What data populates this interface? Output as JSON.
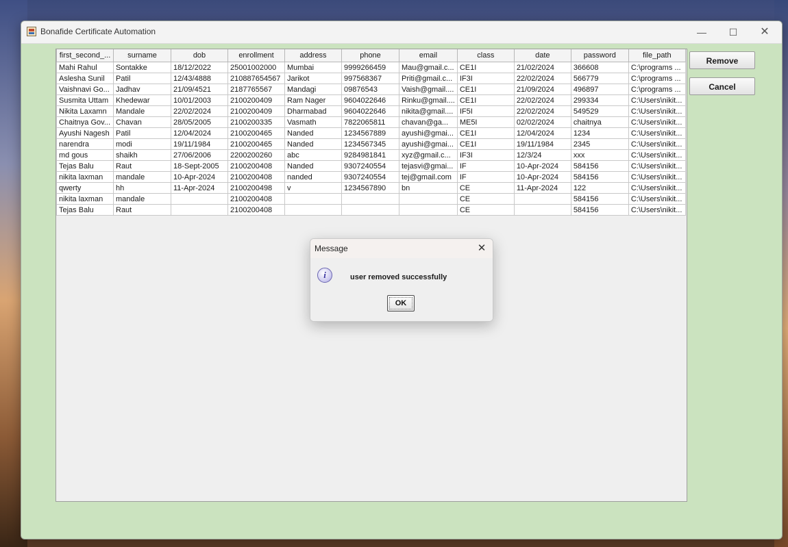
{
  "window": {
    "title": "Bonafide Certificate Automation",
    "minimize_glyph": "—",
    "maximize_glyph": "☐",
    "close_glyph": "✕"
  },
  "table": {
    "columns": [
      "first_second_...",
      "surname",
      "dob",
      "enrollment",
      "address",
      "phone",
      "email",
      "class",
      "date",
      "password",
      "file_path"
    ],
    "rows": [
      [
        "Mahi Rahul",
        "Sontakke",
        "18/12/2022",
        "25001002000",
        "Mumbai",
        "9999266459",
        "Mau@gmail.c...",
        "CE1I",
        "21/02/2024",
        "366608",
        "C:\\programs ..."
      ],
      [
        "Aslesha Sunil",
        "Patil",
        "12/43/4888",
        "210887654567",
        "Jarikot",
        "997568367",
        "Priti@gmail.c...",
        "IF3I",
        "22/02/2024",
        "566779",
        "C:\\programs ..."
      ],
      [
        "Vaishnavi Go...",
        "Jadhav",
        "21/09/4521",
        "2187765567",
        "Mandagi",
        "09876543",
        "Vaish@gmail....",
        "CE1I",
        "21/09/2024",
        "496897",
        "C:\\programs ..."
      ],
      [
        "Susmita Uttam",
        "Khedewar",
        "10/01/2003",
        "2100200409",
        "Ram Nager",
        "9604022646",
        "Rinku@gmail....",
        "CE1I",
        "22/02/2024",
        "299334",
        "C:\\Users\\nikit..."
      ],
      [
        "Nikita Laxamn",
        "Mandale",
        "22/02/2024",
        "2100200409",
        "Dharmabad",
        "9604022646",
        "nikita@gmail....",
        "IF5I",
        "22/02/2024",
        "549529",
        "C:\\Users\\nikit..."
      ],
      [
        "Chaitnya Gov...",
        "Chavan",
        "28/05/2005",
        "2100200335",
        "Vasmath",
        "7822065811",
        "chavan@ga...",
        "ME5I",
        "02/02/2024",
        "chaitnya",
        "C:\\Users\\nikit..."
      ],
      [
        "Ayushi Nagesh",
        "Patil",
        "12/04/2024",
        "2100200465",
        "Nanded",
        "1234567889",
        "ayushi@gmai...",
        "CE1I",
        "12/04/2024",
        "1234",
        "C:\\Users\\nikit..."
      ],
      [
        "narendra",
        "modi",
        "19/11/1984",
        "2100200465",
        "Nanded",
        "1234567345",
        "ayushi@gmai...",
        "CE1I",
        "19/11/1984",
        "2345",
        "C:\\Users\\nikit..."
      ],
      [
        "md gous",
        "shaikh",
        "27/06/2006",
        "2200200260",
        "abc",
        "9284981841",
        "xyz@gmail.c...",
        "IF3I",
        "12/3/24",
        "xxx",
        "C:\\Users\\nikit..."
      ],
      [
        "Tejas Balu",
        "Raut",
        "18-Sept-2005",
        "2100200408",
        "Nanded",
        "9307240554",
        "tejasvi@gmai...",
        "IF",
        "10-Apr-2024",
        "584156",
        "C:\\Users\\nikit..."
      ],
      [
        "nikita laxman",
        "mandale",
        "10-Apr-2024",
        "2100200408",
        "nanded",
        "9307240554",
        "tej@gmail.com",
        "IF",
        "10-Apr-2024",
        "584156",
        "C:\\Users\\nikit..."
      ],
      [
        "qwerty",
        "hh",
        "11-Apr-2024",
        "2100200498",
        "v",
        "1234567890",
        "bn",
        "CE",
        "11-Apr-2024",
        "122",
        "C:\\Users\\nikit..."
      ],
      [
        "nikita laxman",
        "mandale",
        "",
        "2100200408",
        "",
        "",
        "",
        "CE",
        "",
        "584156",
        "C:\\Users\\nikit..."
      ],
      [
        "Tejas Balu",
        "Raut",
        "",
        "2100200408",
        "",
        "",
        "",
        "CE",
        "",
        "584156",
        "C:\\Users\\nikit..."
      ]
    ]
  },
  "buttons": {
    "remove": "Remove",
    "cancel": "Cancel"
  },
  "dialog": {
    "title": "Message",
    "close_glyph": "✕",
    "icon_glyph": "i",
    "message": "user removed successfully",
    "ok_label": "OK"
  }
}
